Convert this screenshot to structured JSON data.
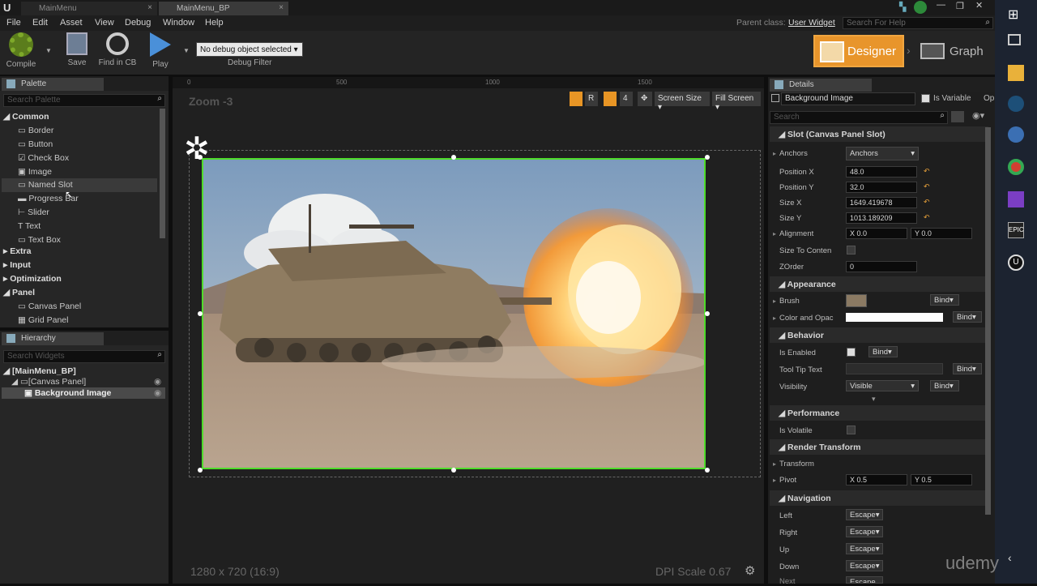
{
  "window": {
    "tabs": [
      "MainMenu",
      "MainMenu_BP"
    ],
    "parent_class_label": "Parent class:",
    "parent_class_value": "User Widget",
    "help_search_placeholder": "Search For Help"
  },
  "menu": [
    "File",
    "Edit",
    "Asset",
    "View",
    "Debug",
    "Window",
    "Help"
  ],
  "toolbar": {
    "compile": "Compile",
    "save": "Save",
    "find_in_cb": "Find in CB",
    "play": "Play",
    "debug_object": "No debug object selected",
    "debug_filter": "Debug Filter",
    "designer": "Designer",
    "graph": "Graph"
  },
  "palette": {
    "title": "Palette",
    "search_placeholder": "Search Palette",
    "common": "Common",
    "items": [
      "Border",
      "Button",
      "Check Box",
      "Image",
      "Named Slot",
      "Progress Bar",
      "Slider",
      "Text",
      "Text Box"
    ],
    "categories": [
      "Extra",
      "Input",
      "Optimization"
    ],
    "panel": "Panel",
    "panel_items": [
      "Canvas Panel",
      "Grid Panel"
    ]
  },
  "hierarchy": {
    "title": "Hierarchy",
    "search_placeholder": "Search Widgets",
    "root": "[MainMenu_BP]",
    "canvas": "[Canvas Panel]",
    "selected": "Background Image"
  },
  "designer": {
    "zoom": "Zoom -3",
    "ruler_marks": [
      "0",
      "500",
      "1000",
      "1500"
    ],
    "btn_r": "R",
    "btn_4": "4",
    "screen_size": "Screen Size",
    "fill_screen": "Fill Screen",
    "resolution": "1280 x 720 (16:9)",
    "dpi_scale": "DPI Scale 0.67"
  },
  "details": {
    "title": "Details",
    "name_value": "Background Image",
    "is_variable": "Is Variable",
    "op_label": "Op",
    "search_placeholder": "Search",
    "slot_section": "Slot (Canvas Panel Slot)",
    "anchors_label": "Anchors",
    "anchors_value": "Anchors",
    "position_x_label": "Position X",
    "position_x": "48.0",
    "position_y_label": "Position Y",
    "position_y": "32.0",
    "size_x_label": "Size X",
    "size_x": "1649.419678",
    "size_y_label": "Size Y",
    "size_y": "1013.189209",
    "alignment_label": "Alignment",
    "alignment_x": "X  0.0",
    "alignment_y": "Y  0.0",
    "size_to_content_label": "Size To Conten",
    "zorder_label": "ZOrder",
    "zorder": "0",
    "appearance_section": "Appearance",
    "brush_label": "Brush",
    "color_label": "Color and Opac",
    "bind": "Bind",
    "behavior_section": "Behavior",
    "is_enabled_label": "Is Enabled",
    "tooltip_label": "Tool Tip Text",
    "visibility_label": "Visibility",
    "visibility_value": "Visible",
    "performance_section": "Performance",
    "is_volatile_label": "Is Volatile",
    "render_section": "Render Transform",
    "transform_label": "Transform",
    "pivot_label": "Pivot",
    "pivot_x": "X  0.5",
    "pivot_y": "Y  0.5",
    "navigation_section": "Navigation",
    "nav_left": "Left",
    "nav_right": "Right",
    "nav_up": "Up",
    "nav_down": "Down",
    "nav_next": "Next",
    "escape": "Escape"
  },
  "watermark": "udemy"
}
